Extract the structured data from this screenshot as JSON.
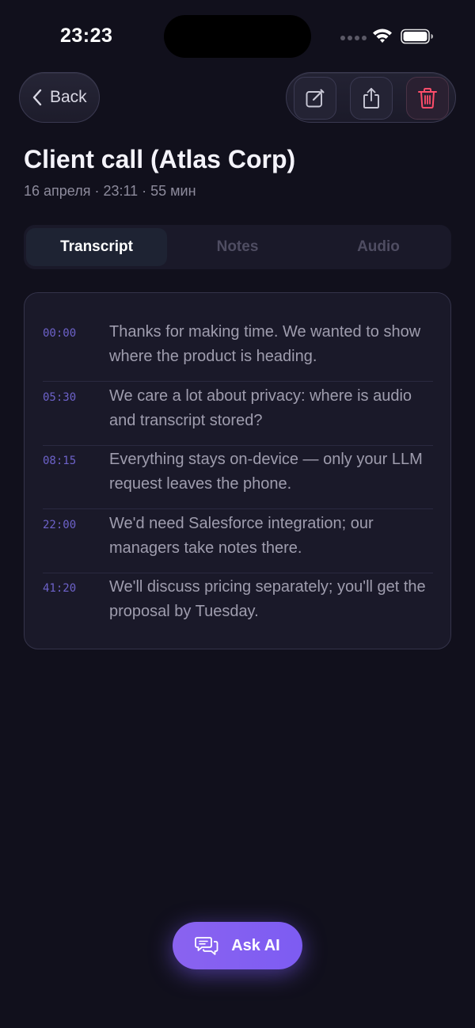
{
  "status_bar": {
    "time": "23:23"
  },
  "nav": {
    "back_label": "Back",
    "actions": [
      {
        "icon": "edit-icon"
      },
      {
        "icon": "share-icon"
      },
      {
        "icon": "trash-icon",
        "color": "#ff4d6a"
      }
    ]
  },
  "header": {
    "title": "Client call (Atlas Corp)",
    "meta": "16 апреля · 23:11 · 55 мин"
  },
  "tabs": [
    {
      "label": "Transcript",
      "active": true
    },
    {
      "label": "Notes",
      "active": false
    },
    {
      "label": "Audio",
      "active": false
    }
  ],
  "transcript": [
    {
      "time": "00:00",
      "text": "Thanks for making time. We wanted to show where the product is heading."
    },
    {
      "time": "05:30",
      "text": "We care a lot about privacy: where is audio and transcript stored?"
    },
    {
      "time": "08:15",
      "text": "Everything stays on-device — only your LLM request leaves the phone."
    },
    {
      "time": "22:00",
      "text": "We'd need Salesforce integration; our managers take notes there."
    },
    {
      "time": "41:20",
      "text": "We'll discuss pricing separately; you'll get the proposal by Tuesday."
    }
  ],
  "ask_ai": {
    "label": "Ask AI"
  },
  "colors": {
    "background": "#11101c",
    "accent": "#7d5cf2",
    "timestamp": "#6d62c9",
    "danger": "#ff4d6a"
  }
}
